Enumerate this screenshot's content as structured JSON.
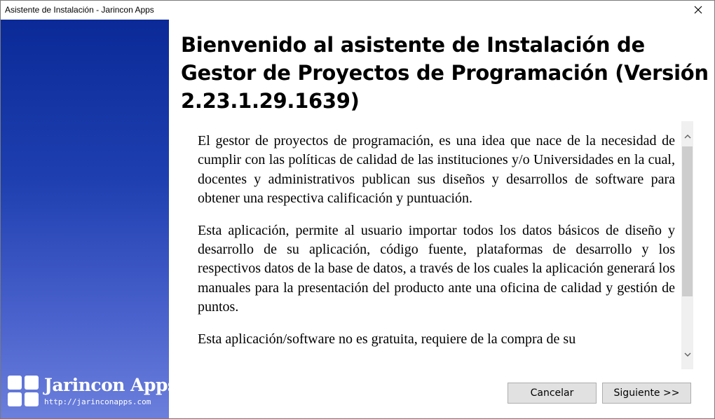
{
  "window": {
    "title": "Asistente de Instalación - Jarincon Apps"
  },
  "sidebar": {
    "brand_name": "Jarincon Apps",
    "brand_url": "http://jarinconapps.com",
    "logo_icon": "four-squares-logo-icon"
  },
  "main": {
    "heading": "Bienvenido al asistente de Instalación de Gestor de Proyectos de Programación (Versión 2.23.1.29.1639)",
    "paragraphs": [
      "El gestor de proyectos de programación, es una idea que nace de la necesidad de cumplir con las políticas de calidad de las instituciones y/o Universidades en la cual, docentes y administrativos publican sus diseños y desarrollos de software para obtener una respectiva calificación y puntuación.",
      "Esta aplicación, permite al usuario importar todos los datos básicos de diseño y desarrollo de su aplicación, código fuente, plataformas de desarrollo y los respectivos datos de la base de datos, a través de los cuales la aplicación generará los manuales para la presentación del producto ante una oficina de calidad y gestión de puntos.",
      "Esta aplicación/software no es gratuita, requiere de la compra de su"
    ]
  },
  "buttons": {
    "cancel": "Cancelar",
    "next": "Siguiente >>"
  },
  "colors": {
    "sidebar_top": "#0b2a98",
    "sidebar_bottom": "#6b7fdc",
    "button_face": "#e1e1e1"
  }
}
